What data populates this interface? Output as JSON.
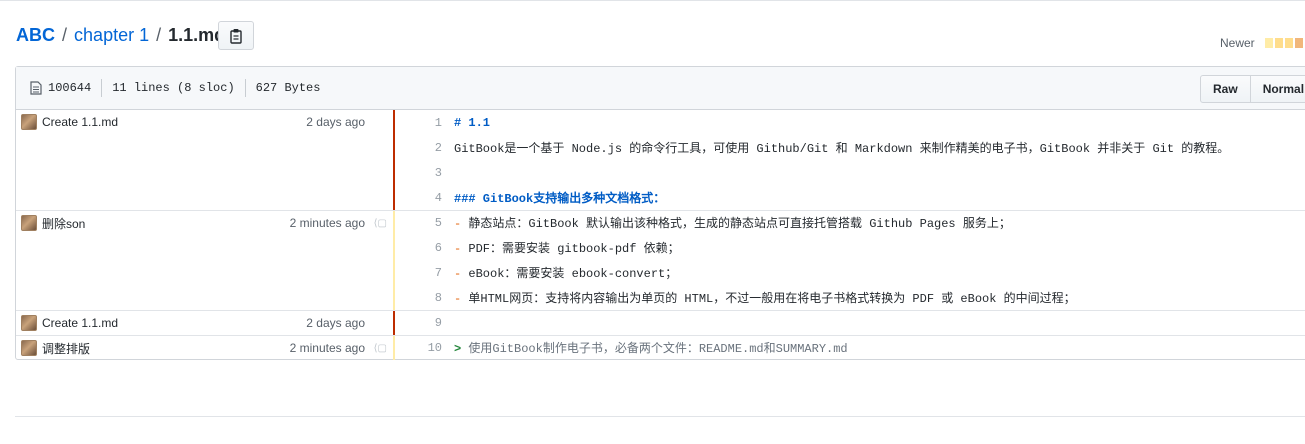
{
  "breadcrumb": {
    "repo": "ABC",
    "sep1": "/",
    "dir": "chapter 1",
    "sep2": "/",
    "file": "1.1.md"
  },
  "newer_label": "Newer",
  "heat_colors": [
    "#ffeca7",
    "#ffdd8c",
    "#ffdd8c",
    "#f1b77b"
  ],
  "file_info": {
    "mode": "100644",
    "lines": "11 lines (8 sloc)",
    "size": "627 Bytes"
  },
  "buttons": {
    "raw": "Raw",
    "normal_view": "Normal view"
  },
  "commits": [
    {
      "message": "Create 1.1.md",
      "age": "2 days ago",
      "heat": "#bd2c00"
    },
    {
      "message": "删除son",
      "age": "2 minutes ago",
      "heat": "#ffeca7"
    },
    {
      "message": "Create 1.1.md",
      "age": "2 days ago",
      "heat": "#bd2c00"
    },
    {
      "message": "调整排版",
      "age": "2 minutes ago",
      "heat": "#ffeca7"
    }
  ],
  "lines": [
    {
      "n": "1",
      "prefix": "# 1.1",
      "text": ""
    },
    {
      "n": "2",
      "prefix": "",
      "text": "GitBook是一个基于 Node.js 的命令行工具，可使用 Github/Git 和 Markdown 来制作精美的电子书，GitBook 并非关于 Git 的教程。"
    },
    {
      "n": "3",
      "prefix": "",
      "text": ""
    },
    {
      "n": "4",
      "prefix": "### GitBook支持输出多种文档格式：",
      "text": ""
    },
    {
      "n": "5",
      "prefix": "-",
      "text": " 静态站点：GitBook 默认输出该种格式，生成的静态站点可直接托管搭载 Github Pages 服务上；"
    },
    {
      "n": "6",
      "prefix": "-",
      "text": " PDF：需要安装 gitbook-pdf 依赖；"
    },
    {
      "n": "7",
      "prefix": "-",
      "text": " eBook：需要安装 ebook-convert；"
    },
    {
      "n": "8",
      "prefix": "-",
      "text": " 单HTML网页：支持将内容输出为单页的 HTML，不过一般用在将电子书格式转换为 PDF 或 eBook 的中间过程；"
    },
    {
      "n": "9",
      "prefix": "",
      "text": ""
    },
    {
      "n": "10",
      "prefix": ">",
      "text": " 使用GitBook制作电子书，必备两个文件：README.md和SUMMARY.md"
    }
  ]
}
